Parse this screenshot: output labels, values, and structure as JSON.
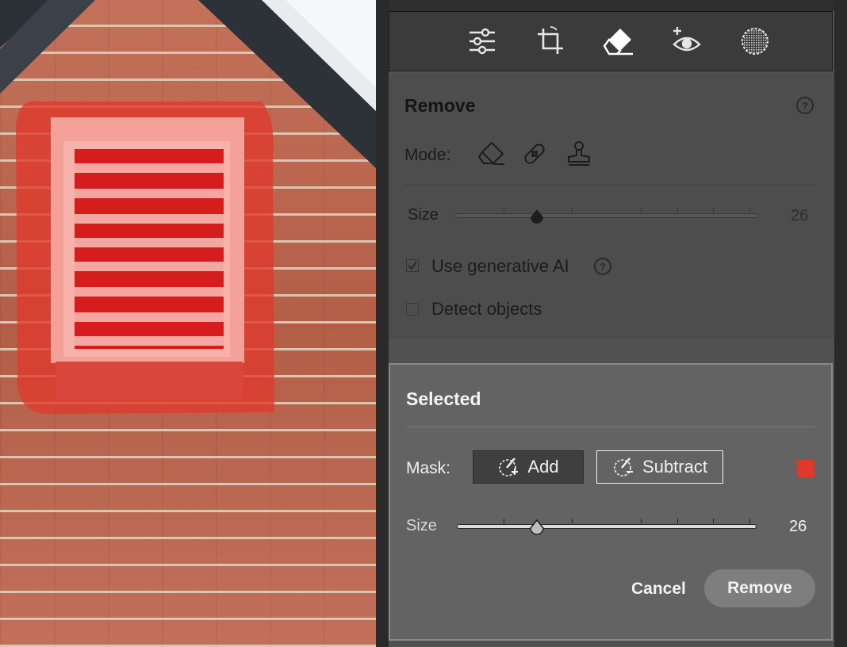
{
  "colors": {
    "mask_red": "#e0392b",
    "panel_bg": "#515151",
    "selected_bg": "#636363",
    "toolbar_bg": "#3b3b3b"
  },
  "toolbar": {
    "tools": [
      {
        "icon": "edit-sliders-icon"
      },
      {
        "icon": "crop-icon"
      },
      {
        "icon": "eraser-icon"
      },
      {
        "icon": "red-eye-icon"
      },
      {
        "icon": "masking-icon"
      }
    ],
    "active_tool": "eraser-icon"
  },
  "remove_panel": {
    "title": "Remove",
    "mode_label": "Mode:",
    "modes": [
      "eraser-icon",
      "bandage-icon",
      "clone-stamp-icon"
    ],
    "size_label": "Size",
    "size_value": "26",
    "size_fraction": 0.27,
    "use_generative_ai_label": "Use generative AI",
    "use_generative_ai_checked": true,
    "detect_objects_label": "Detect objects",
    "detect_objects_checked": false
  },
  "selected_panel": {
    "title": "Selected",
    "mask_label": "Mask:",
    "add_label": "Add",
    "subtract_label": "Subtract",
    "size_label": "Size",
    "size_value": "26",
    "size_fraction": 0.27,
    "cancel_label": "Cancel",
    "remove_label": "Remove"
  }
}
